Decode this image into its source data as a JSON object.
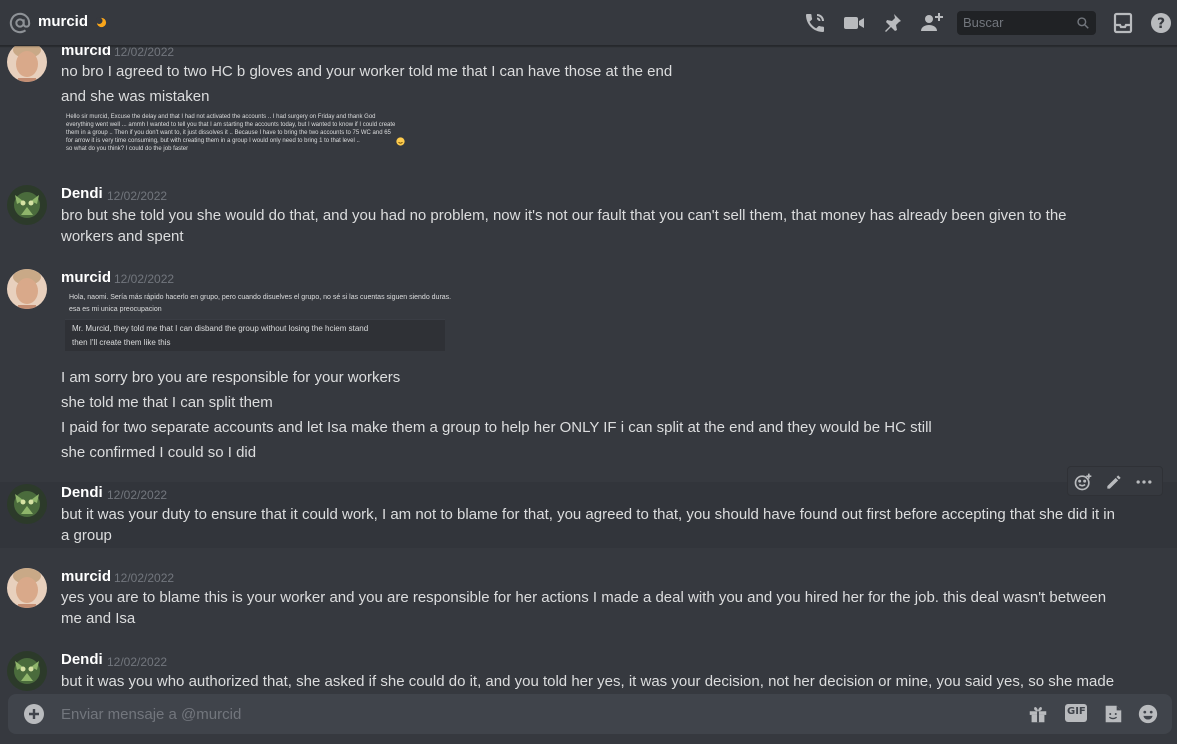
{
  "header": {
    "channel_name": "murcid",
    "search_placeholder": "Buscar"
  },
  "messages": [
    {
      "author": "murcid",
      "timestamp": "12/02/2022",
      "lines": [
        "no bro I agreed to two HC b gloves and your worker told me that I can have those at the end",
        "and she was mistaken"
      ],
      "embed_text": [
        "Hello sir murcid, Excuse the delay and that I had not activated the accounts .. I had surgery on Friday and thank God",
        "everything went well ... ammh I wanted to tell you that I am starting the accounts today, but I wanted to know if I could create",
        "them in a group .. Then if you don't want to, it just dissolves it .. Because I have to bring the two accounts to 75 WC and 65",
        "for arrow it is very time consuming, but with creating them in a group I would only need to bring 1 to that level ..",
        "so what do you think? I could do the job faster"
      ]
    },
    {
      "author": "Dendi",
      "timestamp": "12/02/2022",
      "lines": [
        "bro but she told you she would do that, and you had no problem, now it's not our fault that you can't sell them, that money has already been given to the workers and spent"
      ]
    },
    {
      "author": "murcid",
      "timestamp": "12/02/2022",
      "embed_text": [
        "Hola, naomi. Sería más rápido hacerlo en grupo, pero cuando disuelves el grupo, no sé si las cuentas siguen siendo duras.",
        "esa es mi unica preocupacion",
        "Mr. Murcid, they told me that I can disband the group without losing the hciem stand",
        "then I'll create them like this"
      ],
      "lines": [
        "I am sorry bro you are responsible for your workers",
        "she told me that I can split them",
        "I paid for two separate accounts and let Isa make them a group to help her ONLY IF i can split at the end and they would be HC still",
        "she confirmed I could so I did"
      ]
    },
    {
      "author": "Dendi",
      "timestamp": "12/02/2022",
      "lines": [
        "but it was your duty to ensure that it could work, I am not to blame for that, you agreed to that, you should have found out first before accepting that she did it in a group"
      ]
    },
    {
      "author": "murcid",
      "timestamp": "12/02/2022",
      "lines": [
        "yes you are to blame this is your worker and you are responsible for her actions I made a deal with you and you hired her for the job. this deal wasn't between me and Isa"
      ]
    },
    {
      "author": "Dendi",
      "timestamp": "12/02/2022",
      "lines": [
        "but it was you who authorized that, she asked if she could do it, and you told her yes, it was your decision, not her decision or mine, you said yes, so she made a group"
      ]
    }
  ],
  "composer": {
    "placeholder": "Enviar mensaje a @murcid",
    "gif_label": "GIF"
  },
  "colors": {
    "background": "#36393f",
    "input_bg": "#40444b",
    "text": "#dcddde",
    "muted": "#72767d",
    "author": "#ffffff"
  }
}
